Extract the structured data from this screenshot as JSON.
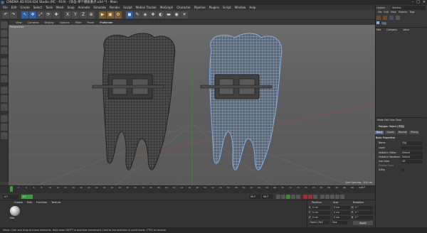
{
  "window": {
    "title": "CINEMA 4D R19.024 Studio (RC - R19) - [牙齿-单个模板重点.c4d *] - Main",
    "controls": [
      "–",
      "□",
      "×"
    ]
  },
  "menubar": [
    "File",
    "Edit",
    "Create",
    "Select",
    "Tools",
    "Mesh",
    "Snap",
    "Animate",
    "Simulate",
    "Render",
    "Sculpt",
    "Motion Tracker",
    "MoGraph",
    "Character",
    "Pipeline",
    "Plugins",
    "Script",
    "Window",
    "Help"
  ],
  "toolbar_letters": {
    "x": "X",
    "y": "Y",
    "z": "Z"
  },
  "viewport": {
    "menu": [
      "View",
      "Cameras",
      "Display",
      "Options",
      "Filter",
      "Panel",
      "ProRender"
    ],
    "active_menu": "ProRender",
    "label": "Perspective",
    "grid_spacing": "Grid Spacing : 100 cm"
  },
  "timeline": {
    "ticks": [
      "0",
      "2",
      "4",
      "6",
      "8",
      "10",
      "12",
      "14",
      "16",
      "18",
      "20",
      "22",
      "24",
      "26",
      "28",
      "30",
      "32",
      "34",
      "36",
      "38",
      "40",
      "42",
      "44",
      "46",
      "48",
      "50",
      "52",
      "54",
      "56",
      "58",
      "60",
      "62",
      "64",
      "66",
      "68",
      "70",
      "72",
      "74",
      "76",
      "78",
      "80",
      "82",
      "84",
      "86",
      "88",
      "90"
    ],
    "frame": "0 F"
  },
  "transport": {
    "start": "0 F",
    "current": "0 F",
    "end": "90 F",
    "end2": "90 F"
  },
  "materials": {
    "tabs": [
      "Create",
      "Edit",
      "Function",
      "Texture"
    ],
    "material_name": "Mat"
  },
  "coordinates": {
    "headers": [
      "Position",
      "Size",
      "Rotation"
    ],
    "rows": [
      {
        "axis": "X",
        "pos": "0 cm",
        "size": "0 cm",
        "rot_axis": "H",
        "rot": "0 °"
      },
      {
        "axis": "Y",
        "pos": "0 cm",
        "size": "0 cm",
        "rot_axis": "P",
        "rot": "0 °"
      },
      {
        "axis": "Z",
        "pos": "0 cm",
        "size": "0 cm",
        "rot_axis": "B",
        "rot": "0 °"
      }
    ],
    "mode": "Object (Rel)",
    "size_mode": "Size",
    "apply": "Apply"
  },
  "right_panel": {
    "layout_label": "Layout:",
    "layout_value": "Startup",
    "om_menu": [
      "File",
      "Edit",
      "View",
      "Objects",
      "Tags",
      "Bookmarks"
    ],
    "om_headers": [
      "Mode",
      "Edit",
      "User Data"
    ],
    "object": "牙齿",
    "mat_headers": [
      "Mat",
      "Category",
      "Value"
    ]
  },
  "attributes": {
    "header": "Mode  Edit  User Data",
    "object_title": "Polygon Object [牙齿]",
    "tabs": [
      "Basic",
      "Coord.",
      "Normal",
      "Phong"
    ],
    "section": "Basic Properties",
    "rows": [
      {
        "label": "Name",
        "value": "牙齿"
      },
      {
        "label": "Layer",
        "value": ""
      },
      {
        "label": "Visible in Editor",
        "value": "Default"
      },
      {
        "label": "Visible in Renderer",
        "value": "Default"
      },
      {
        "label": "Use Color",
        "value": "Off"
      },
      {
        "label": "Display Color",
        "value": ""
      },
      {
        "label": "X-Ray",
        "value": ""
      }
    ]
  },
  "status": "Move: Click and drag to move elements. Hold down SHIFT to quantize movement / add to the selection in point mode, CTRL to remove.",
  "colors": {
    "wire_selected": "#7fb2e6",
    "wire_default": "#2b2b2b",
    "accent": "#2f5fa0"
  }
}
